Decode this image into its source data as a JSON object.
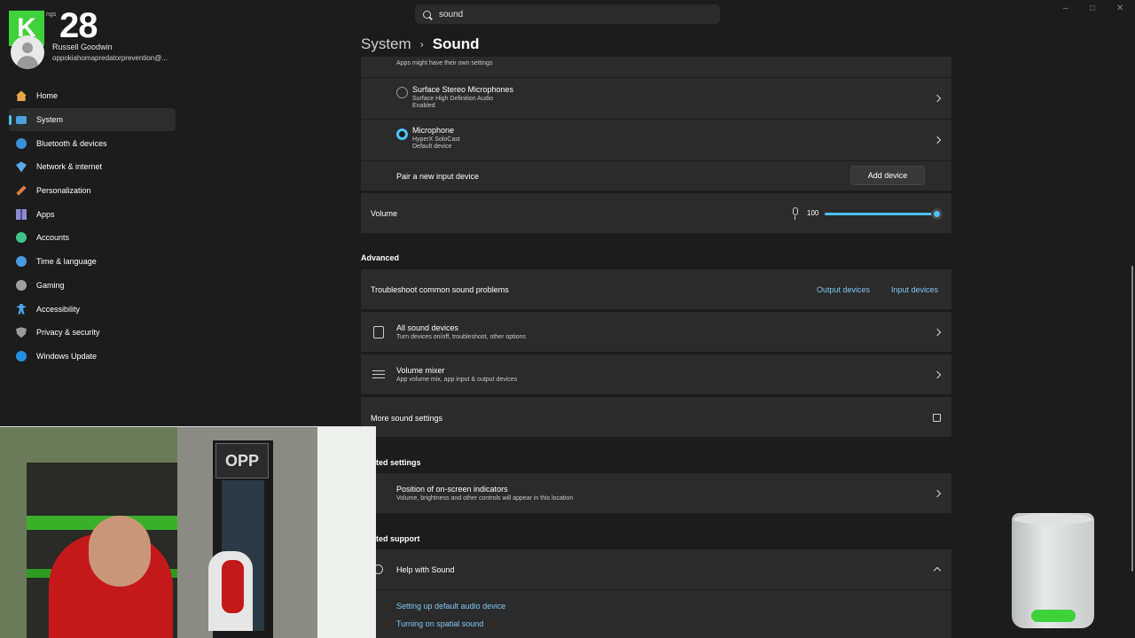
{
  "window": {
    "search_value": "sound",
    "controls": {
      "minimize": "–",
      "maximize": "□",
      "close": "✕"
    }
  },
  "overlay": {
    "badge_letter": "K",
    "badge_number": "28",
    "settings_fragment": "ngs"
  },
  "user": {
    "name": "Russell Goodwin",
    "email": "oppokiahomapredatorprevention@..."
  },
  "sidebar": {
    "items": [
      {
        "label": "Home",
        "icon": "home-icon"
      },
      {
        "label": "System",
        "icon": "system-icon",
        "active": true
      },
      {
        "label": "Bluetooth & devices",
        "icon": "bluetooth-icon"
      },
      {
        "label": "Network & internet",
        "icon": "wifi-icon"
      },
      {
        "label": "Personalization",
        "icon": "brush-icon"
      },
      {
        "label": "Apps",
        "icon": "apps-icon"
      },
      {
        "label": "Accounts",
        "icon": "accounts-icon"
      },
      {
        "label": "Time & language",
        "icon": "globe-clock-icon"
      },
      {
        "label": "Gaming",
        "icon": "gaming-icon"
      },
      {
        "label": "Accessibility",
        "icon": "accessibility-icon"
      },
      {
        "label": "Privacy & security",
        "icon": "shield-icon"
      },
      {
        "label": "Windows Update",
        "icon": "update-icon"
      }
    ]
  },
  "header": {
    "parent": "System",
    "separator": "›",
    "current": "Sound"
  },
  "input": {
    "truncated_note": "Apps might have their own settings",
    "devices": [
      {
        "name": "Surface Stereo Microphones",
        "sub": "Surface High Definition Audio",
        "status": "Enabled",
        "selected": false
      },
      {
        "name": "Microphone",
        "sub": "HyperX SoloCast",
        "status": "Default device",
        "selected": true
      }
    ],
    "pair_label": "Pair a new input device",
    "add_device_label": "Add device",
    "volume_label": "Volume",
    "volume_value": "100",
    "volume_level": 100
  },
  "advanced": {
    "heading": "Advanced",
    "troubleshoot_label": "Troubleshoot common sound problems",
    "output_devices_link": "Output devices",
    "input_devices_link": "Input devices",
    "all_sound_devices": {
      "title": "All sound devices",
      "sub": "Turn devices on/off, troubleshoot, other options"
    },
    "volume_mixer": {
      "title": "Volume mixer",
      "sub": "App volume mix, app input & output devices"
    },
    "more_sound_settings": "More sound settings"
  },
  "related_settings": {
    "heading": "ted settings",
    "position_indicators": {
      "title": "Position of on-screen indicators",
      "sub": "Volume, brightness and other controls will appear in this location"
    }
  },
  "related_support": {
    "heading": "ted support",
    "help_title": "Help with Sound",
    "links": [
      "Setting up default audio device",
      "Turning on spatial sound"
    ]
  },
  "colors": {
    "accent": "#4cc2ff",
    "background": "#1c1c1c",
    "card": "#2b2b2b",
    "overlay_green": "#3fd13a"
  }
}
